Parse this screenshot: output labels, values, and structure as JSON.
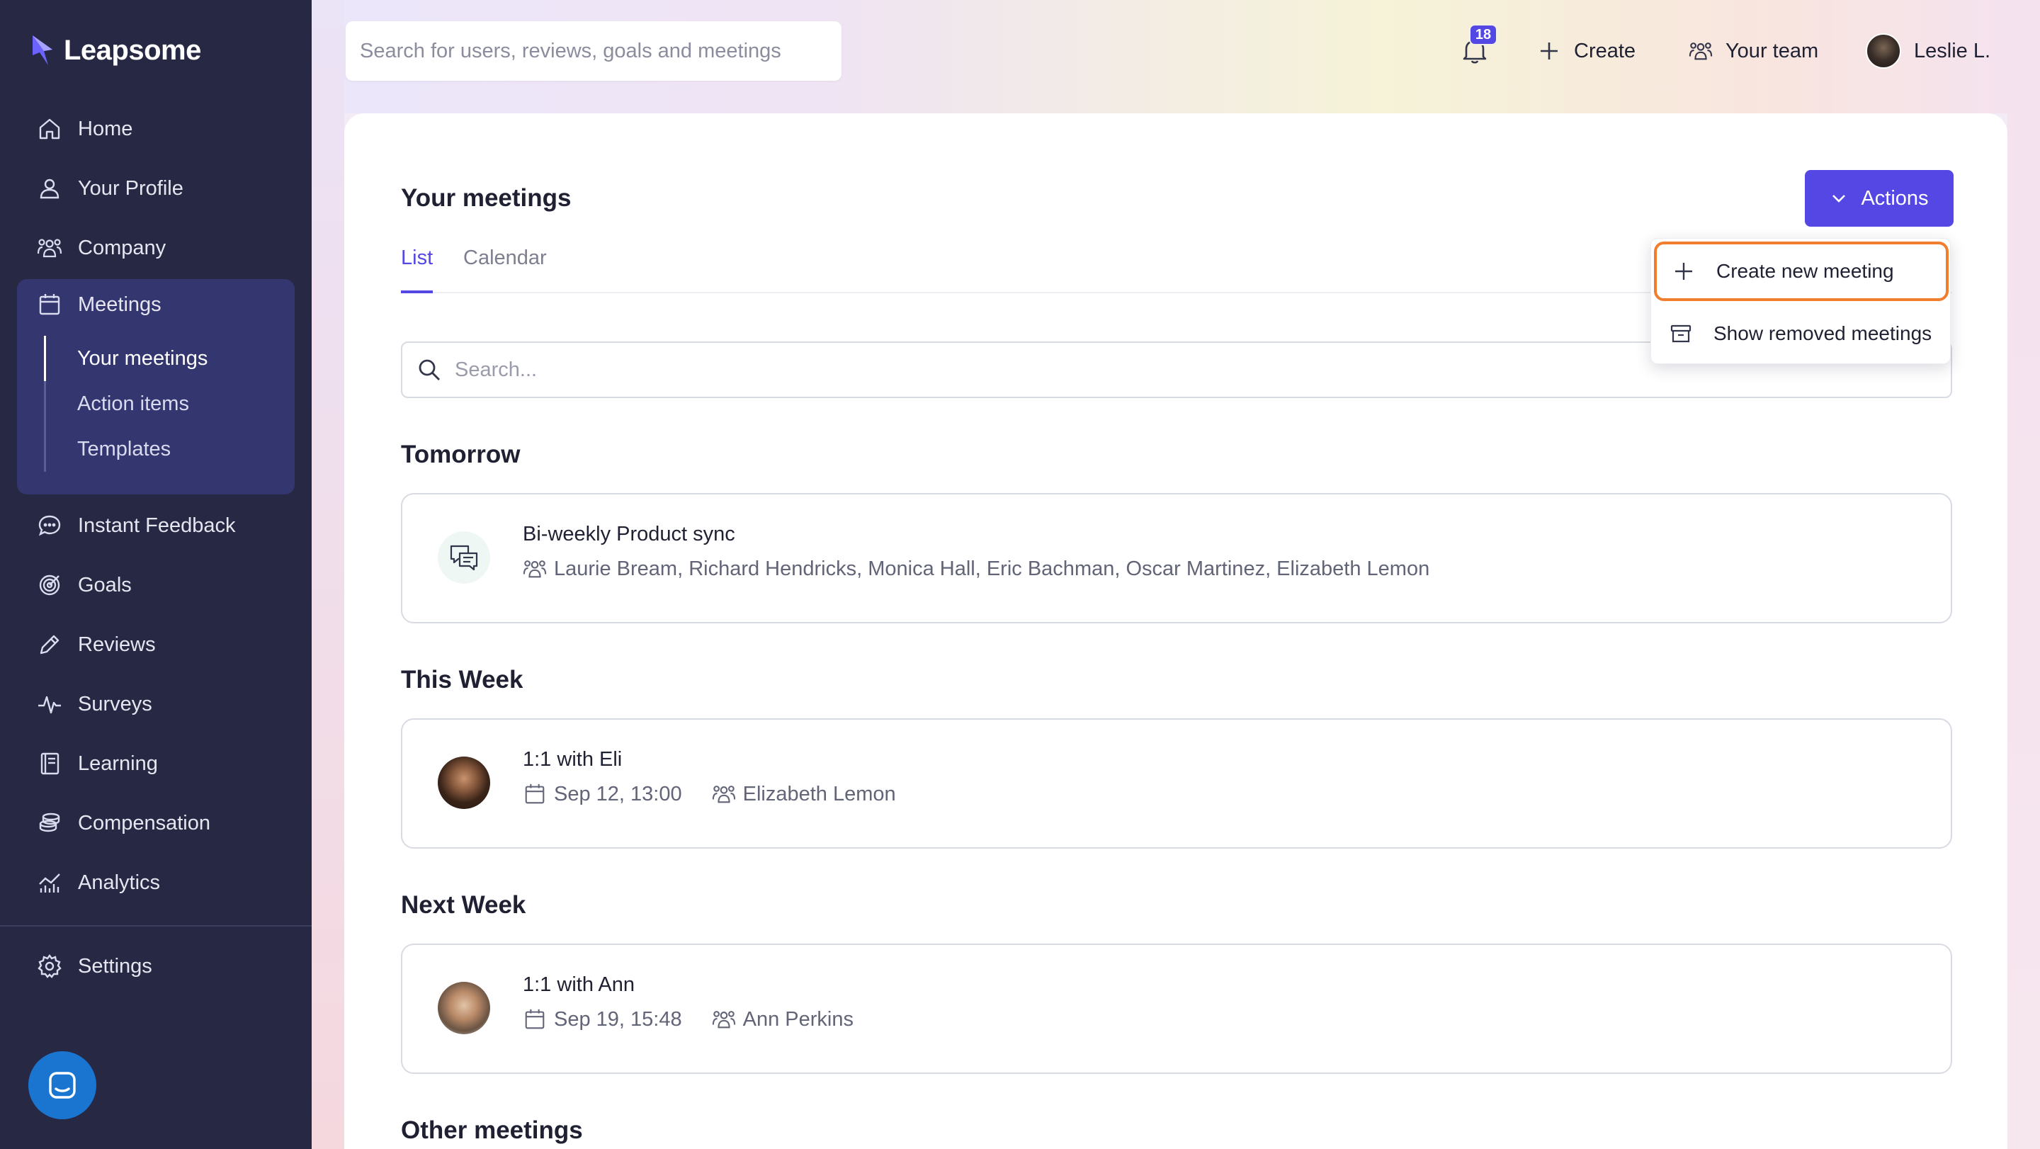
{
  "app": {
    "name": "Leapsome"
  },
  "sidebar": {
    "items": [
      {
        "label": "Home",
        "icon": "home-icon"
      },
      {
        "label": "Your Profile",
        "icon": "user-icon"
      },
      {
        "label": "Company",
        "icon": "people-icon"
      },
      {
        "label": "Meetings",
        "icon": "calendar-icon"
      },
      {
        "label": "Instant Feedback",
        "icon": "chat-icon"
      },
      {
        "label": "Goals",
        "icon": "target-icon"
      },
      {
        "label": "Reviews",
        "icon": "pencil-icon"
      },
      {
        "label": "Surveys",
        "icon": "pulse-icon"
      },
      {
        "label": "Learning",
        "icon": "book-icon"
      },
      {
        "label": "Compensation",
        "icon": "coins-icon"
      },
      {
        "label": "Analytics",
        "icon": "chart-icon"
      },
      {
        "label": "Settings",
        "icon": "gear-icon"
      }
    ],
    "meetings_sub": [
      {
        "label": "Your meetings",
        "active": true
      },
      {
        "label": "Action items",
        "active": false
      },
      {
        "label": "Templates",
        "active": false
      }
    ]
  },
  "topbar": {
    "search_placeholder": "Search for users, reviews, goals and meetings",
    "notification_count": "18",
    "create_label": "Create",
    "team_label": "Your team",
    "user_label": "Leslie L."
  },
  "page": {
    "title": "Your meetings",
    "actions_label": "Actions",
    "tabs": [
      {
        "label": "List",
        "active": true
      },
      {
        "label": "Calendar",
        "active": false
      }
    ],
    "search_placeholder": "Search..."
  },
  "dropdown": {
    "items": [
      {
        "label": "Create new meeting",
        "icon": "plus-icon"
      },
      {
        "label": "Show removed meetings",
        "icon": "archive-icon"
      }
    ]
  },
  "sections": [
    {
      "title": "Tomorrow",
      "meeting": {
        "title": "Bi-weekly Product sync",
        "date": "",
        "participants": "Laurie Bream, Richard Hendricks, Monica Hall, Eric Bachman, Oscar Martinez, Elizabeth Lemon"
      }
    },
    {
      "title": "This Week",
      "meeting": {
        "title": "1:1 with Eli",
        "date": "Sep 12, 13:00",
        "participants": "Elizabeth Lemon"
      }
    },
    {
      "title": "Next Week",
      "meeting": {
        "title": "1:1 with Ann",
        "date": "Sep 19, 15:48",
        "participants": "Ann Perkins"
      }
    },
    {
      "title": "Other meetings"
    }
  ],
  "colors": {
    "sidebar_bg": "#262844",
    "sidebar_active_group": "#343670",
    "accent": "#5447e3",
    "highlight_outline": "#f07e2c",
    "chat_widget": "#1a75d1"
  }
}
